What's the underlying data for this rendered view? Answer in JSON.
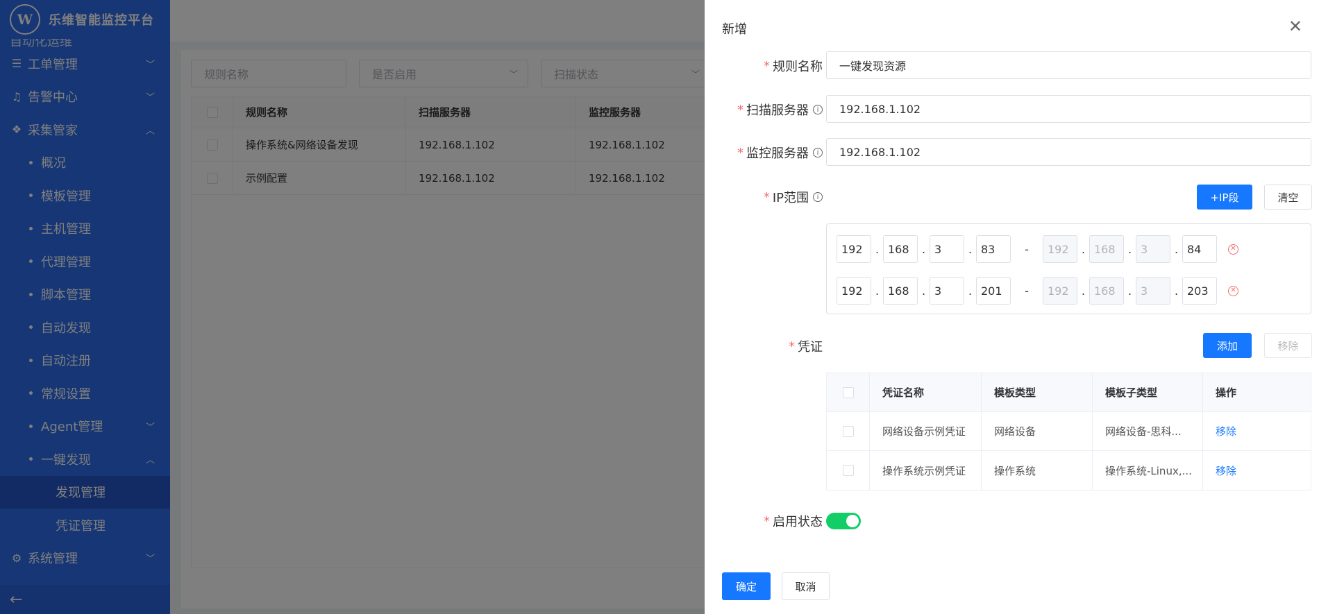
{
  "sidebar": {
    "brand_logo": "W",
    "brand": "乐维智能监控平台",
    "cut_item": "自动化运维",
    "menus": {
      "workorder": "工单管理",
      "alarm": "告警中心",
      "collect": "采集管家",
      "system": "系统管理"
    },
    "sub_items": [
      "概况",
      "模板管理",
      "主机管理",
      "代理管理",
      "脚本管理",
      "自动发现",
      "自动注册",
      "常规设置",
      "Agent管理",
      "一键发现"
    ],
    "subsub_items": [
      "发现管理",
      "凭证管理"
    ]
  },
  "filters": {
    "rule_name": "规则名称",
    "enabled": "是否启用",
    "scan_status": "扫描状态"
  },
  "main_table": {
    "headers": [
      "规则名称",
      "扫描服务器",
      "监控服务器"
    ],
    "rows": [
      [
        "操作系统&网络设备发现",
        "192.168.1.102",
        "192.168.1.102"
      ],
      [
        "示例配置",
        "192.168.1.102",
        "192.168.1.102"
      ]
    ]
  },
  "drawer": {
    "title": "新增",
    "close": "✕",
    "labels": {
      "rule_name": "规则名称",
      "scan_server": "扫描服务器",
      "monitor_server": "监控服务器",
      "ip_range": "IP范围",
      "credential": "凭证",
      "enable_status": "启用状态"
    },
    "values": {
      "rule_name": "一键发现资源",
      "scan_server": "192.168.1.102",
      "monitor_server": "192.168.1.102"
    },
    "buttons": {
      "add_ip": "+IP段",
      "clear": "清空",
      "add": "添加",
      "remove": "移除",
      "confirm": "确定",
      "cancel": "取消"
    },
    "ip_ranges": [
      {
        "start": [
          "192",
          "168",
          "3",
          "83"
        ],
        "end": [
          "192",
          "168",
          "3",
          "84"
        ]
      },
      {
        "start": [
          "192",
          "168",
          "3",
          "201"
        ],
        "end": [
          "192",
          "168",
          "3",
          "203"
        ]
      }
    ],
    "cred_table": {
      "headers": [
        "凭证名称",
        "模板类型",
        "模板子类型",
        "操作"
      ],
      "rows": [
        {
          "name": "网络设备示例凭证",
          "type": "网络设备",
          "subtype": "网络设备-思科...",
          "action": "移除"
        },
        {
          "name": "操作系统示例凭证",
          "type": "操作系统",
          "subtype": "操作系统-Linux,...",
          "action": "移除"
        }
      ]
    },
    "enabled": true
  },
  "colors": {
    "sidebar": "#2d6cea",
    "primary": "#1677ff",
    "switch_on": "#13ce66",
    "required": "#f56c6c"
  }
}
